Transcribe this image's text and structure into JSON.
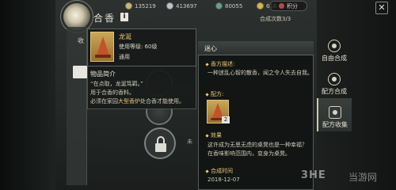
{
  "header": {
    "title": "合香",
    "info_label": "i",
    "synthesis_count": "合成次数3/3"
  },
  "resources": [
    {
      "value": "135219",
      "icon": "coin-icon"
    },
    {
      "value": "413697",
      "icon": "silver-icon"
    },
    {
      "value": "80055",
      "icon": "jade-icon"
    },
    {
      "value": "616",
      "icon": "gold-icon"
    }
  ],
  "points_button": "积分",
  "close_label": "✕",
  "tabs": [
    {
      "label": "自由合成",
      "active": false
    },
    {
      "label": "配方合成",
      "active": false
    },
    {
      "label": "配方收集",
      "active": true
    }
  ],
  "left_panel": {
    "tab_label": "收"
  },
  "item_tooltip": {
    "name": "龙涎",
    "level": "使用等级: 60级",
    "type": "通用",
    "intro_title": "物品简介",
    "intro_lines": [
      "“在点取，龙涎笃羁。”",
      "用于合香的香料。",
      "必须在家园",
      "处合香才能使用。"
    ],
    "highlight": "大型香炉"
  },
  "main_area": {
    "side_text": "未"
  },
  "detail": {
    "title": "迷心",
    "desc_label": "香方描述:",
    "desc_text": "一种迷乱心智的散香，闻之令人失去自我。",
    "recipe_label": "配方:",
    "recipe_count": "2",
    "effect_label": "效果",
    "effect_lines": [
      "这许成为无思无虑的桌凳也是一种幸福？",
      "在香味影响范围内，变身为桌凳。"
    ],
    "time_label": "合成时间",
    "time_value": "2018-12-07"
  },
  "watermark": {
    "brand": "3HE",
    "site": "当游网"
  },
  "colors": {
    "accent_gold": "#e9c977",
    "panel_bg": "#181b1a",
    "text": "#cfcab9"
  }
}
